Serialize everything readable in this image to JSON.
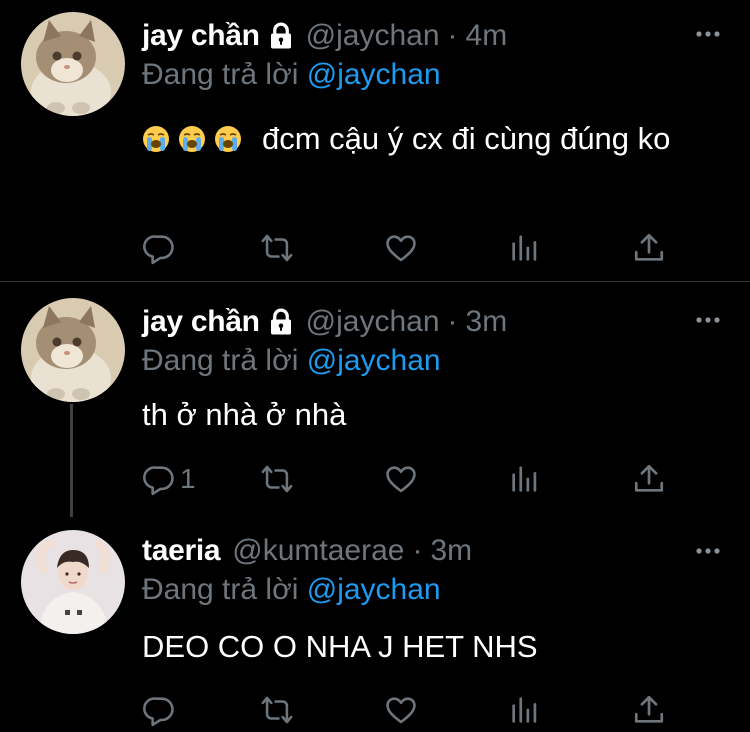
{
  "accent_colors": {
    "link": "#1d9bf0",
    "muted": "#6e767d",
    "background": "#000000"
  },
  "tweets": [
    {
      "display_name": "jay chần",
      "handle": "@jaychan",
      "separator": "·",
      "time": "4m",
      "reply_prefix": "Đang trả lời",
      "reply_to": "@jaychan",
      "emojis": [
        "loudly-crying-face-emoji",
        "loudly-crying-face-emoji",
        "loudly-crying-face-emoji"
      ],
      "text": "đcm cậu ý cx đi cùng đúng ko",
      "reply_count": "",
      "icons": [
        "lock-icon",
        "more-icon",
        "reply-icon",
        "retweet-icon",
        "like-icon",
        "analytics-icon",
        "share-icon"
      ]
    },
    {
      "display_name": "jay chần",
      "handle": "@jaychan",
      "separator": "·",
      "time": "3m",
      "reply_prefix": "Đang trả lời",
      "reply_to": "@jaychan",
      "text": "th ở nhà ở nhà",
      "reply_count": "1"
    },
    {
      "display_name": "taeria",
      "handle": "@kumtaerae",
      "separator": "·",
      "time": "3m",
      "reply_prefix": "Đang trả lời",
      "reply_to": "@jaychan",
      "text": "DEO CO O NHA J HET NHS",
      "reply_count": ""
    }
  ]
}
